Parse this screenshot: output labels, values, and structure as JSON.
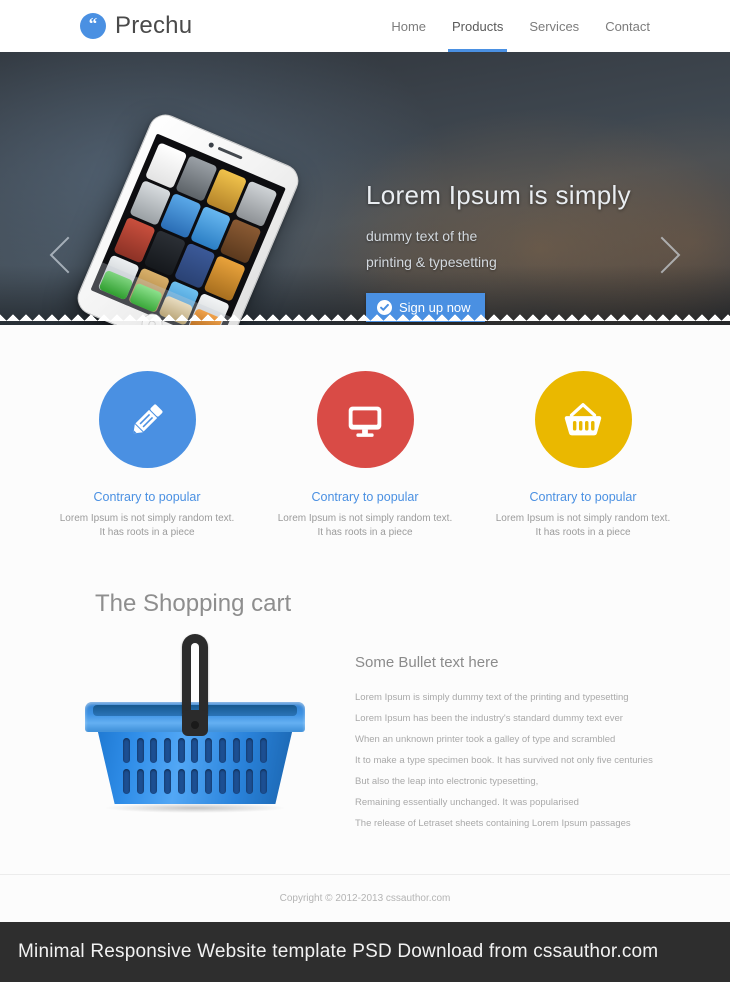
{
  "header": {
    "logo": {
      "icon": "quote-icon",
      "glyph": "“",
      "text": "Prechu",
      "color": "#4a90e2"
    },
    "nav": [
      {
        "label": "Home",
        "active": false
      },
      {
        "label": "Products",
        "active": true
      },
      {
        "label": "Services",
        "active": false
      },
      {
        "label": "Contact",
        "active": false
      }
    ]
  },
  "hero": {
    "title": "Lorem Ipsum is simply",
    "sub_line1": "dummy text of the",
    "sub_line2": "printing & typesetting",
    "button": {
      "label": "Sign up now",
      "icon": "check-circle-icon",
      "color": "#4a90e2"
    },
    "prev_arrow": "chevron-left-icon",
    "next_arrow": "chevron-right-icon",
    "image": "iphone-5-white-angled"
  },
  "features": [
    {
      "icon": "pencil-icon",
      "circle_color": "#4a90e2",
      "title": "Contrary to popular",
      "text_line1": "Lorem Ipsum is not simply random text.",
      "text_line2": "It has roots in a piece"
    },
    {
      "icon": "monitor-icon",
      "circle_color": "#d94b46",
      "title": "Contrary to popular",
      "text_line1": "Lorem Ipsum is not simply random text.",
      "text_line2": "It has roots in a piece"
    },
    {
      "icon": "basket-icon",
      "circle_color": "#eab800",
      "title": "Contrary to popular",
      "text_line1": "Lorem Ipsum is not simply random text.",
      "text_line2": "It has roots in a piece"
    }
  ],
  "shopping": {
    "title": "The Shopping cart",
    "image": "blue-shopping-basket",
    "bullets_title": "Some Bullet text here",
    "bullets": [
      "Lorem Ipsum is simply dummy text of the printing and typesetting",
      "Lorem Ipsum has been the industry's standard dummy text ever",
      "When an unknown printer took a galley of type and scrambled",
      "It to make a type specimen book. It has survived not only five centuries",
      "But also the leap into electronic typesetting,",
      "Remaining essentially unchanged. It was popularised",
      "The release of Letraset sheets containing Lorem Ipsum passages"
    ]
  },
  "footer": {
    "copyright": "Copyright © 2012-2013 cssauthor.com"
  },
  "banner": {
    "text": "Minimal Responsive Website template PSD Download from cssauthor.com"
  }
}
